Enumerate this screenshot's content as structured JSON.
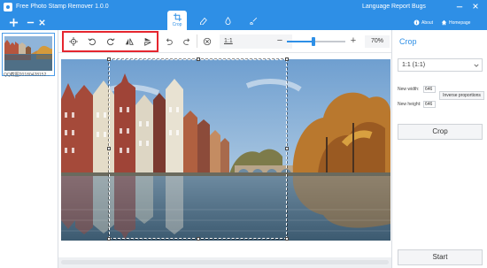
{
  "app": {
    "title": "Free Photo Stamp Remover 1.0.0"
  },
  "titlebar": {
    "add_icon": "plus-icon",
    "remove_icon": "minus-icon",
    "close_icon": "close-icon",
    "modes": [
      {
        "label": "Crop",
        "icon": "crop-icon",
        "active": true
      },
      {
        "label": "",
        "icon": "eraser-icon",
        "active": false
      },
      {
        "label": "",
        "icon": "drop-icon",
        "active": false
      },
      {
        "label": "",
        "icon": "brush-icon",
        "active": false
      }
    ],
    "language_label": "Language",
    "report_label": "Report Bugs",
    "about_label": "About",
    "homepage_label": "Homepage"
  },
  "files": [
    {
      "caption": "QQ截图20180428152..."
    }
  ],
  "toolbar": {
    "tools": [
      "target-icon",
      "rotate-left-icon",
      "rotate-right-icon",
      "flip-horizontal-icon",
      "flip-vertical-icon",
      "undo-icon",
      "redo-icon",
      "cancel-icon"
    ],
    "ratio_label": "1:1",
    "zoom_minus": "−",
    "zoom_plus": "+",
    "zoom_value": "70%",
    "zoom_fraction": 0.45
  },
  "panel": {
    "title": "Crop",
    "ratio_selected": "1:1 (1:1)",
    "width_label": "New width:",
    "width_value": "646",
    "height_label": "New height:",
    "height_value": "646",
    "inverse_label": "Inverse proportions",
    "crop_button": "Crop",
    "start_button": "Start"
  },
  "colors": {
    "accent": "#2e8fe6",
    "highlight": "#e5262f"
  }
}
